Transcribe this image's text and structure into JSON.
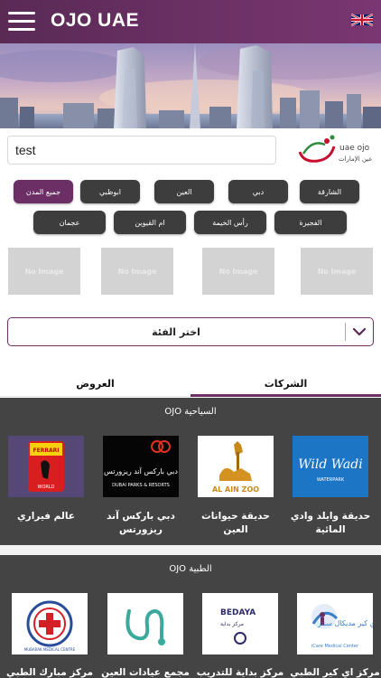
{
  "header": {
    "title": "OJO UAE"
  },
  "search": {
    "value": "test"
  },
  "brand": {
    "line1": "uae ojo",
    "line2": "عين الإمارات"
  },
  "cities": [
    "جميع المدن",
    "ابوظبي",
    "العين",
    "دبي",
    "الشارقة",
    "عجمان",
    "ام القيوين",
    "رأس الخيمة",
    "الفجيرة"
  ],
  "placeholder_text": "No Image",
  "category": {
    "label": "اختر الفئة"
  },
  "tabs": {
    "offers": "العروض",
    "companies": "الشركات"
  },
  "sections": [
    {
      "title": "OJO السياحية",
      "items": [
        {
          "label_line1": "عالم فيراري",
          "label_line2": "",
          "logo_text": "FERRARI WORLD"
        },
        {
          "label_line1": "دبي باركس آند",
          "label_line2": "ريزورتس",
          "logo_text": "DUBAI PARKS & RESORTS",
          "logo_ar": "دبي باركس آند ريزورتس"
        },
        {
          "label_line1": "حديقة حيوانات العين",
          "label_line2": "",
          "logo_text": "AL AIN ZOO"
        },
        {
          "label_line1": "حديقة وايلد وادي",
          "label_line2": "المائية",
          "logo_text": "Wild Wadi",
          "logo_sub": "WATERPARK"
        }
      ]
    },
    {
      "title": "OJO الطبية",
      "items": [
        {
          "label_line1": "مركز مبارك الطبي",
          "logo_text": "MUBARAK MEDICAL CENTRE"
        },
        {
          "label_line1": "مجمع عيادات العين",
          "logo_text": ""
        },
        {
          "label_line1": "مركز بداية للتدريب",
          "logo_text": "BEDAYA",
          "logo_ar": "مركز بداية"
        },
        {
          "label_line1": "مركز اي كير الطبي",
          "logo_text": "iCare Medical Center",
          "logo_ar": "اي كير مديكال سنتر"
        }
      ]
    }
  ],
  "colors": {
    "primary": "#6b2f66",
    "chip": "#3d3d3d",
    "section_bg": "#444444"
  }
}
